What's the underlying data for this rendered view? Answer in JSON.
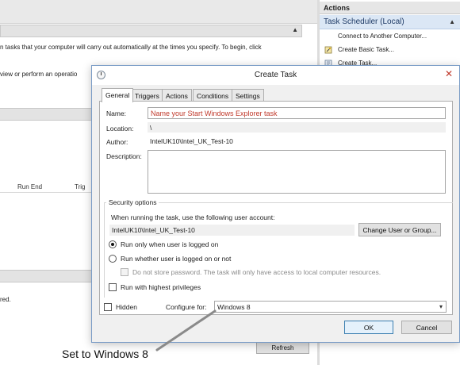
{
  "background": {
    "intro_line1": "n tasks that your computer will carry out automatically at the times you specify. To begin, click",
    "intro_line2": "view or perform an operatio",
    "grid_headers": [
      "Run End",
      "Trig"
    ],
    "status_fragment": "red.",
    "refresh_label": "Refresh"
  },
  "actions_pane": {
    "header": "Actions",
    "subheader": "Task Scheduler (Local)",
    "items": [
      {
        "label": "Connect to Another Computer...",
        "icon": "none"
      },
      {
        "label": "Create Basic Task...",
        "icon": "wizard-icon"
      },
      {
        "label": "Create Task...",
        "icon": "create-task-icon"
      }
    ]
  },
  "dialog": {
    "title": "Create Task",
    "tabs": [
      "General",
      "Triggers",
      "Actions",
      "Conditions",
      "Settings"
    ],
    "active_tab": "General",
    "name_label": "Name:",
    "name_value": "Name your Start Windows Explorer task",
    "location_label": "Location:",
    "location_value": "\\",
    "author_label": "Author:",
    "author_value": "IntelUK10\\Intel_UK_Test-10",
    "description_label": "Description:",
    "description_value": "",
    "security": {
      "title": "Security options",
      "account_prompt": "When running the task, use the following user account:",
      "account_value": "IntelUK10\\Intel_UK_Test-10",
      "change_button": "Change User or Group...",
      "radio_logged_on": "Run only when user is logged on",
      "radio_logged_on_selected": true,
      "radio_whether": "Run whether user is logged on or not",
      "radio_whether_selected": false,
      "no_store_password": "Do not store password.  The task will only have access to local computer resources.",
      "highest_privileges": "Run with highest privileges"
    },
    "hidden_label": "Hidden",
    "configure_label": "Configure for:",
    "configure_value": "Windows 8",
    "ok_label": "OK",
    "cancel_label": "Cancel"
  },
  "annotation": {
    "callout_text": "Set to Windows 8"
  },
  "colors": {
    "name_text": "#c0392b",
    "actions_subheader_bg": "#dbe7f5",
    "annotation_line": "#8a8a8a"
  }
}
